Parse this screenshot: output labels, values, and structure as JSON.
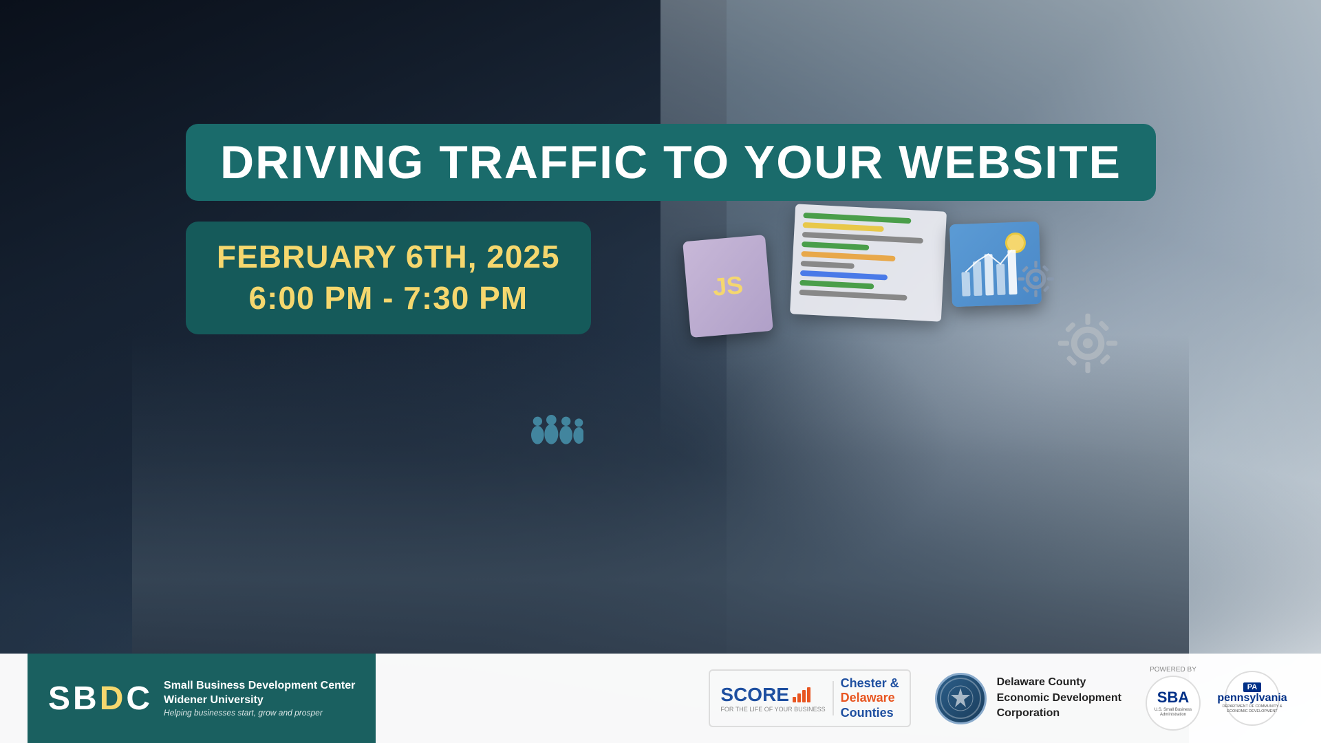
{
  "background": {
    "colors": {
      "dark": "#0d1b2a",
      "teal": "#1a6b6b",
      "light": "#e8ecef"
    }
  },
  "event": {
    "title": "DRIVING TRAFFIC TO YOUR WEBSITE",
    "date": "FEBRUARY 6TH, 2025",
    "time": "6:00 PM - 7:30 PM"
  },
  "footer": {
    "sbdc": {
      "letters": "SBDC",
      "highlight_letter": "D",
      "org_name": "Small Business Development Center",
      "university": "Widener University",
      "tagline": "Helping businesses start, grow and prosper"
    },
    "score": {
      "name": "SCORE",
      "tagline": "FOR THE LIFE OF YOUR BUSINESS",
      "counties": "Chester &",
      "counties2": "Delaware",
      "counties3": "Counties"
    },
    "delaware_county": {
      "name": "Delaware County",
      "subtitle": "Economic Development",
      "subtitle2": "Corporation"
    },
    "sba": {
      "powered_by": "POWERED BY",
      "name": "SBA",
      "tagline": "U.S. Small Business Administration"
    },
    "pa": {
      "badge": "PA",
      "name": "pennsylvania",
      "tagline": "DEPARTMENT OF COMMUNITY & ECONOMIC DEVELOPMENT"
    }
  }
}
